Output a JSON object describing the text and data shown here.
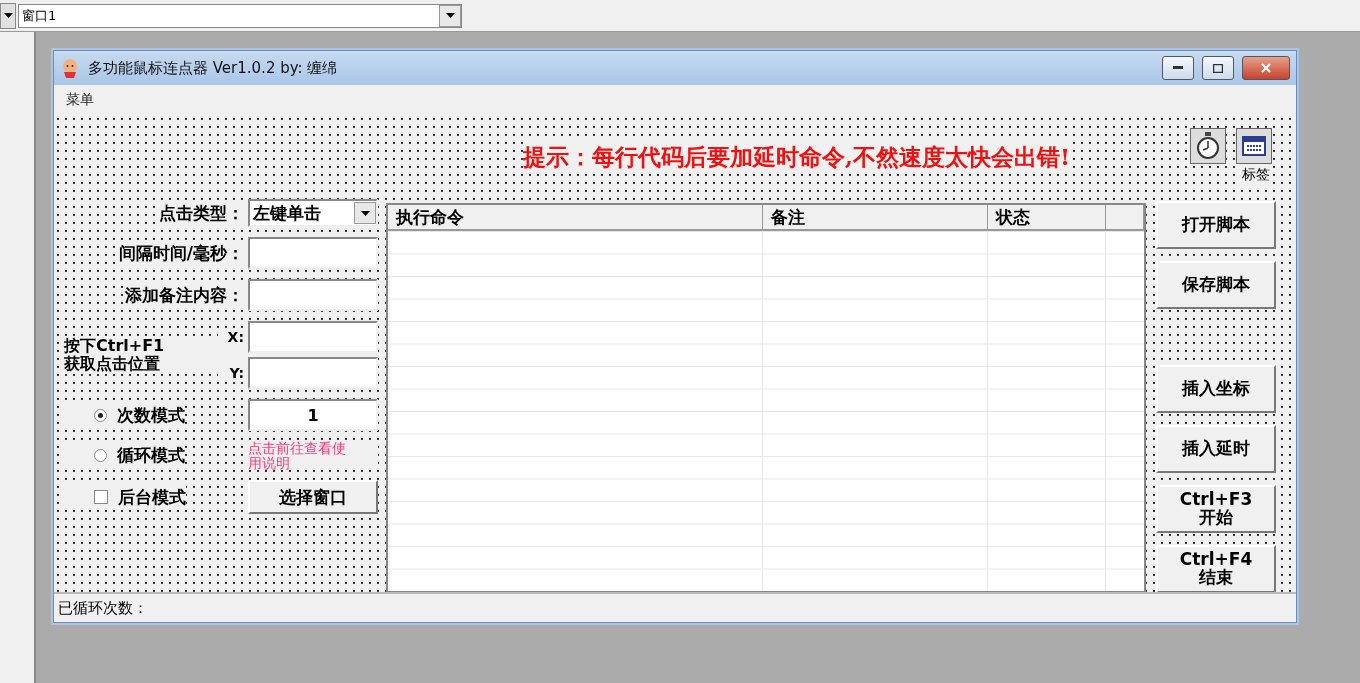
{
  "toolbar": {
    "object_combo": "窗口1"
  },
  "window": {
    "title": "多功能鼠标连点器 Ver1.0.2 by: 缠绵",
    "menu": [
      "菜单"
    ]
  },
  "hint": "提示：每行代码后要加延时命令,不然速度太快会出错!",
  "components": [
    {
      "kind": "timer"
    },
    {
      "kind": "label",
      "caption": "标签"
    }
  ],
  "click_type": {
    "label": "点击类型：",
    "value": "左键单击"
  },
  "fields": [
    {
      "label": "间隔时间/毫秒："
    },
    {
      "label": "添加备注内容："
    }
  ],
  "capture": {
    "lines": [
      "按下Ctrl+F1",
      "获取点击位置"
    ],
    "x_label": "X:",
    "y_label": "Y:"
  },
  "modes": [
    {
      "label": "次数模式",
      "selected": true
    },
    {
      "label": "循环模式",
      "selected": false
    }
  ],
  "count": "1",
  "help_link": [
    "点击前往查看使",
    "用说明"
  ],
  "background_mode": {
    "label": "后台模式",
    "checked": false
  },
  "select_window_button": "选择窗口",
  "table": {
    "columns": [
      "执行命令",
      "备注",
      "状态"
    ]
  },
  "buttons": [
    {
      "lines": [
        "打开脚本"
      ]
    },
    {
      "lines": [
        "保存脚本"
      ]
    },
    {
      "lines": [
        "插入坐标"
      ]
    },
    {
      "lines": [
        "插入延时"
      ]
    },
    {
      "lines": [
        "Ctrl+F3",
        "开始"
      ]
    },
    {
      "lines": [
        "Ctrl+F4",
        "结束"
      ]
    }
  ],
  "status_bar": "已循环次数："
}
